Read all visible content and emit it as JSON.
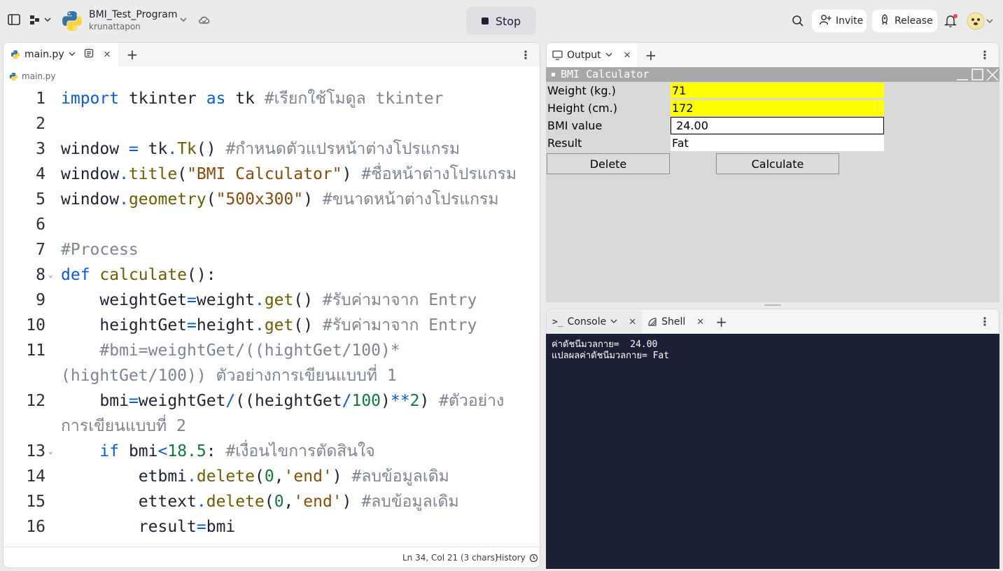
{
  "project": {
    "name": "BMI_Test_Program",
    "user": "krunattapon"
  },
  "topbar": {
    "stop_label": "Stop",
    "invite_label": "Invite",
    "release_label": "Release"
  },
  "editor": {
    "tab_label": "main.py",
    "breadcrumb": "main.py",
    "lines": [
      {
        "n": "1",
        "fold": "",
        "html": "<span class=\"kw\">import</span> tkinter <span class=\"kw\">as</span> tk <span class=\"cm\">#เรียกใช้โมดูล tkinter</span>"
      },
      {
        "n": "2",
        "fold": "",
        "html": ""
      },
      {
        "n": "3",
        "fold": "",
        "html": "window <span class=\"op\">=</span> tk<span class=\"op\">.</span><span class=\"fn\">Tk</span>() <span class=\"cm\">#กำหนดตัวแปรหน้าต่างโปรแกรม</span>"
      },
      {
        "n": "4",
        "fold": "",
        "html": "window<span class=\"op\">.</span><span class=\"fn\">title</span>(<span class=\"str\">\"BMI Calculator\"</span>) <span class=\"cm\">#ชื่อหน้าต่างโปรแกรม</span>"
      },
      {
        "n": "5",
        "fold": "",
        "html": "window<span class=\"op\">.</span><span class=\"fn\">geometry</span>(<span class=\"str\">\"500x300\"</span>) <span class=\"cm\">#ขนาดหน้าต่างโปรแกรม</span>"
      },
      {
        "n": "6",
        "fold": "",
        "html": ""
      },
      {
        "n": "7",
        "fold": "",
        "html": "<span class=\"cm\">#Process</span>"
      },
      {
        "n": "8",
        "fold": "⌄",
        "html": "<span class=\"kw\">def</span> <span class=\"fn\">calculate</span>():"
      },
      {
        "n": "9",
        "fold": "",
        "html": "    weightGet<span class=\"op\">=</span>weight<span class=\"op\">.</span><span class=\"fn\">get</span>() <span class=\"cm\">#รับค่ามาจาก Entry</span>"
      },
      {
        "n": "10",
        "fold": "",
        "html": "    heightGet<span class=\"op\">=</span>height<span class=\"op\">.</span><span class=\"fn\">get</span>() <span class=\"cm\">#รับค่ามาจาก Entry</span>"
      },
      {
        "n": "11",
        "fold": "",
        "html": "    <span class=\"cm\">#bmi=weightGet/((hightGet/100)*</span>"
      },
      {
        "n": "",
        "fold": "",
        "html": "<span class=\"cm\">(hightGet/100)) ตัวอย่างการเขียนแบบที่ 1</span>"
      },
      {
        "n": "12",
        "fold": "",
        "html": "    bmi<span class=\"op\">=</span>weightGet<span class=\"op\">/</span>((heightGet<span class=\"op\">/</span><span class=\"num\">100</span>)<span class=\"op\">**</span><span class=\"num\">2</span>) <span class=\"cm\">#ตัวอย่าง</span>"
      },
      {
        "n": "",
        "fold": "",
        "html": "<span class=\"cm\">การเขียนแบบที่ 2</span>"
      },
      {
        "n": "13",
        "fold": "⌄",
        "html": "    <span class=\"kw\">if</span> bmi<span class=\"op\">&lt;</span><span class=\"num\">18.5</span>: <span class=\"cm\">#เงื่อนไขการตัดสินใจ</span>"
      },
      {
        "n": "14",
        "fold": "",
        "html": "        etbmi<span class=\"op\">.</span><span class=\"fn\">delete</span>(<span class=\"num\">0</span>,<span class=\"str\">'end'</span>) <span class=\"cm\">#ลบข้อมูลเดิม</span>"
      },
      {
        "n": "15",
        "fold": "",
        "html": "        ettext<span class=\"op\">.</span><span class=\"fn\">delete</span>(<span class=\"num\">0</span>,<span class=\"str\">'end'</span>) <span class=\"cm\">#ลบข้อมูลเดิม</span>"
      },
      {
        "n": "16",
        "fold": "",
        "html": "        result<span class=\"op\">=</span>bmi"
      }
    ],
    "status": "Ln 34, Col 21 (3 chars)",
    "history_label": "History"
  },
  "output": {
    "tab_label": "Output",
    "window_title": "BMI Calculator",
    "weight_label": "Weight (kg.)",
    "weight_value": "71",
    "height_label": "Height (cm.)",
    "height_value": "172",
    "bmi_label": "BMI value",
    "bmi_value": " 24.00",
    "result_label": "Result",
    "result_value": "Fat",
    "delete_label": "Delete",
    "calculate_label": "Calculate"
  },
  "console": {
    "tab_label": "Console",
    "shell_label": "Shell",
    "lines": [
      "ค่าดัชนีมวลกาย=  24.00",
      "แปลผลค่าดัชนีมวลกาย= Fat"
    ]
  },
  "colors": {
    "entry_highlight": "#ffff00",
    "console_bg": "#1c2035"
  }
}
